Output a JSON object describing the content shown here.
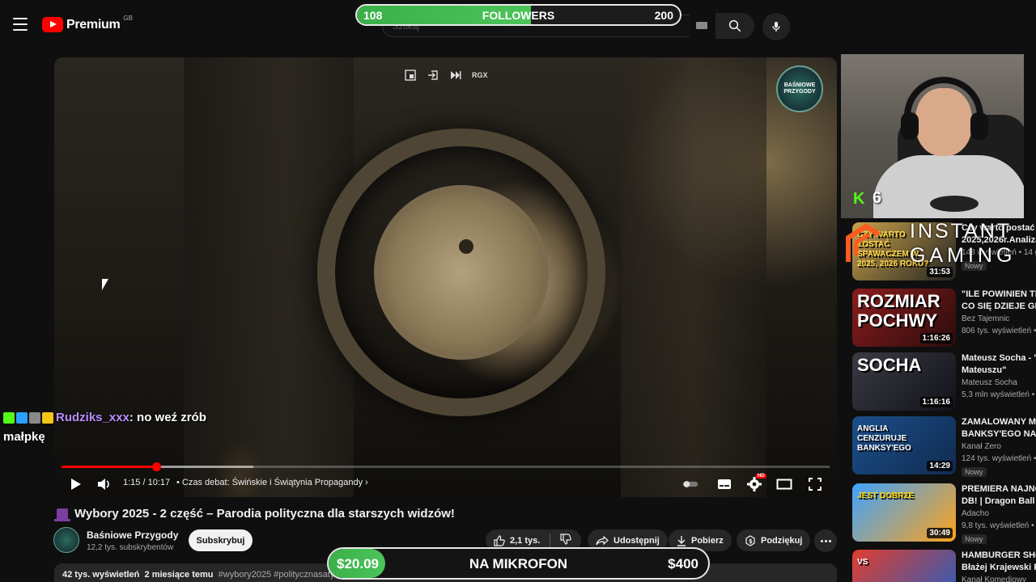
{
  "header": {
    "logo_text": "Premium",
    "logo_country": "GB",
    "search_placeholder": "Szukaj"
  },
  "followers_bar": {
    "current": "108",
    "label": "FOLLOWERS",
    "goal": "200",
    "progress_fraction": 0.54,
    "fill_color": "#3ab049"
  },
  "player": {
    "overlay_badge": "RGX",
    "channel_badge_text": "BAŚNIOWE PRZYGODY",
    "time": "1:15 / 10:17",
    "chapter": "• Czas debat: Świńskie i Świątynia Propagandy",
    "played_fraction": 0.123,
    "loaded_fraction": 0.25,
    "hd_badge": "HD"
  },
  "video": {
    "title": "Wybory 2025 - 2 część – Parodia polityczna dla starszych widzów!",
    "channel": "Baśniowe Przygody",
    "subscribers": "12,2 tys. subskrybentów",
    "subscribe_label": "Subskrybuj",
    "likes": "2,1 tys.",
    "share_label": "Udostępnij",
    "download_label": "Pobierz",
    "thanks_label": "Podziękuj",
    "views": "42 tys. wyświetleń",
    "age": "2 miesiące temu",
    "tags": "#wybory2025 #politycznasatyra #parodiapolityczna"
  },
  "mikrofon_bar": {
    "current": "$20.09",
    "label": "NA MIKROFON",
    "goal": "$400",
    "progress_fraction": 0.05
  },
  "chat": {
    "user": "Rudziks_xxx",
    "message": ": no weź zrób małpkę"
  },
  "webcam": {
    "kick_count": "6"
  },
  "instant_gaming": {
    "line1": "INSTANT",
    "line2": "GAMING"
  },
  "recommendations": [
    {
      "title": "Czy warto postać s",
      "title2": "2025,2026r.Analiza",
      "channel": "",
      "views": "148 wyświetleń • 14 g",
      "duration": "31:53",
      "badge": "Nowy",
      "thumb_text": "CZY WARTO ZOSTAĆ SPAWACZEM W 2025, 2026 ROKU?"
    },
    {
      "title": "\"ILE POWINIEN TRW",
      "title2": "CO SIĘ DZIEJE GDY",
      "channel": "Bez Tajemnic",
      "views": "806 tys. wyświetleń • 1",
      "duration": "1:16:26",
      "badge": "",
      "thumb_text": "ROZMIAR POCHWY"
    },
    {
      "title": "Mateusz Socha - \"P",
      "title2": "Mateuszu\"",
      "channel": "Mateusz Socha",
      "views": "5,3 mln wyświetleń • 9",
      "duration": "1:16:16",
      "badge": "",
      "thumb_text": "SOCHA"
    },
    {
      "title": "ZAMALOWANY MU",
      "title2": "BANKSY'EGO NA LO",
      "channel": "Kanał Zero",
      "views": "124 tys. wyświetleń • 1",
      "duration": "14:29",
      "badge": "Nowy",
      "thumb_text": "ANGLIA CENZURUJE BANKSY'EGO"
    },
    {
      "title": "PREMIERA NAJNO",
      "title2": "DB! | Dragon Ball Ge",
      "channel": "Adacho",
      "views": "9,8 tys. wyświetleń • 1",
      "duration": "30:49",
      "badge": "Nowy",
      "thumb_text": "JEST DOBRZE"
    },
    {
      "title": "HAMBURGER SHOW",
      "title2": "Błażej Krajewski P",
      "channel": "Kanał Komediowy",
      "views": "",
      "duration": "",
      "badge": "",
      "thumb_text": "VS"
    }
  ]
}
